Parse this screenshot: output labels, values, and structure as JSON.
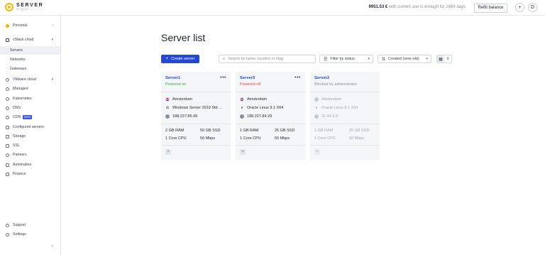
{
  "brand": {
    "name": "SERVER",
    "sub": "SPACE"
  },
  "header": {
    "balance_amount": "9951.53 €",
    "balance_text": "with current use is enough for 1684 days",
    "refill_label": "Refill balance",
    "add_label": "+",
    "avatar_label": "D"
  },
  "sidebar": {
    "personal": "Personal",
    "vstack": "vStack cloud",
    "vstack_items": [
      "Servers",
      "Networks",
      "Gateways"
    ],
    "items": [
      "VMware cloud",
      "Managed",
      "Kubernetes",
      "DNS",
      "CDN",
      "Configured servers",
      "Storage",
      "SSL",
      "Partners",
      "Automation",
      "Finance"
    ],
    "beta_label": "BETA",
    "support": "Support",
    "settings": "Settings",
    "collapse_label": "<"
  },
  "main": {
    "title": "Server list",
    "create_label": "Create server",
    "search_placeholder": "Search by name, location or #tag",
    "filter_label": "Filter by status",
    "sort_label": "Created (new–old)"
  },
  "servers": [
    {
      "name": "Server1",
      "status": "Powered on",
      "status_color": "#3aa34a",
      "location": "Amsterdam",
      "os": "Windows Server 2019 Std ...",
      "ip": "188.227.85.49",
      "ram": "2 GB RAM",
      "ssd": "50 GB SSD",
      "cpu": "1 Core CPU",
      "net": "50 Mbps"
    },
    {
      "name": "Server3",
      "status": "Powered off",
      "status_color": "#e04545",
      "location": "Amsterdam",
      "os": "Oracle Linux 9.1 X64",
      "ip": "188.227.84.29",
      "ram": "1 GB RAM",
      "ssd": "25 GB SSD",
      "cpu": "1 Core CPU",
      "net": "50 Mbps"
    },
    {
      "name": "Server2",
      "status": "Blocked by administrator",
      "status_color": "#8a909c",
      "location": "Amsterdam",
      "os": "Oracle Linux 9.1 X64",
      "ip": "31.44.3.9",
      "ram": "1 GB RAM",
      "ssd": "25 GB SSD",
      "cpu": "1 Core CPU",
      "net": "50 Mbps"
    }
  ],
  "colors": {
    "accent": "#2448d6",
    "brand": "#f2b705"
  }
}
